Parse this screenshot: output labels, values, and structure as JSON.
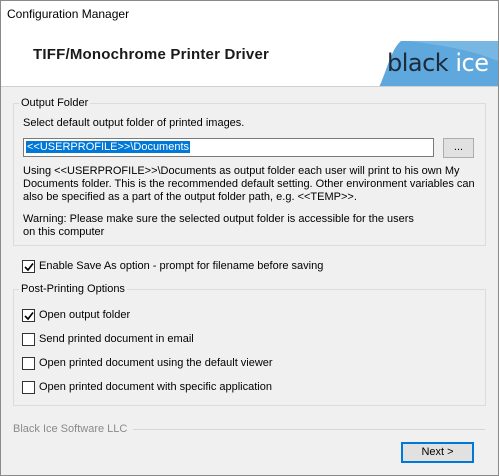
{
  "window": {
    "title": "Configuration Manager"
  },
  "banner": {
    "product_title": "TIFF/Monochrome Printer Driver",
    "logo_text_black": "black",
    "logo_text_ice": "ice",
    "logo_color": "#5fa8dd"
  },
  "output_folder": {
    "group_label": "Output Folder",
    "instruction": "Select default output folder of printed images.",
    "path_value": "<<USERPROFILE>>\\Documents",
    "browse_label": "...",
    "help_lines": [
      "Using <<USERPROFILE>>\\Documents as output folder each user will print to his own My",
      "Documents folder. This is the recommended default setting. Other environment variables can",
      "also be specified as a part of the output folder path, e.g. <<TEMP>>."
    ],
    "warning_lines": [
      "Warning:  Please make sure the selected output folder is accessible for the users",
      "on this computer"
    ]
  },
  "save_as": {
    "label": "Enable Save As option - prompt for filename before saving",
    "checked": true
  },
  "post_printing": {
    "group_label": "Post-Printing Options",
    "options": [
      {
        "label": "Open output folder",
        "checked": true
      },
      {
        "label": "Send printed document in email",
        "checked": false
      },
      {
        "label": "Open printed document using the default viewer",
        "checked": false
      },
      {
        "label": "Open printed document with specific application",
        "checked": false
      }
    ]
  },
  "footer": {
    "company": "Black Ice Software LLC",
    "next_label": "Next >"
  },
  "colors": {
    "accent": "#0078d7",
    "dialog_bg": "#f0f0f0"
  }
}
